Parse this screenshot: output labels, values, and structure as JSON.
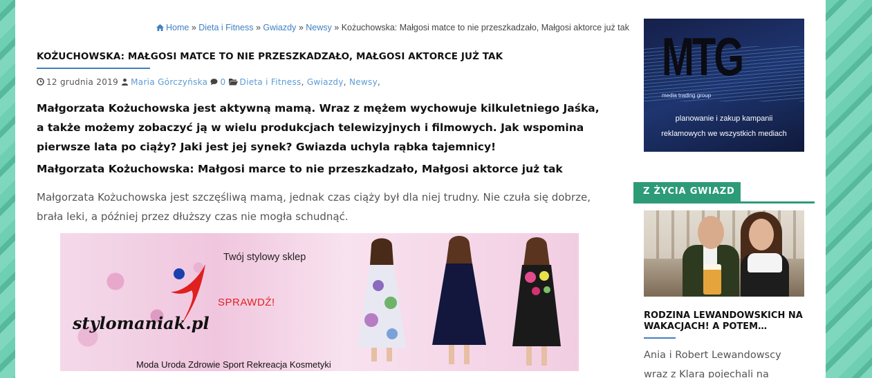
{
  "breadcrumb": {
    "home": "Home",
    "sep": "»",
    "items": [
      "Dieta i Fitness",
      "Gwiazdy",
      "Newsy"
    ],
    "current": "Kożuchowska: Małgosi matce to nie przeszkadzało, Małgosi aktorce już tak"
  },
  "post": {
    "title": "KOŻUCHOWSKA: MAŁGOSI MATCE TO NIE PRZESZKADZAŁO, MAŁGOSI AKTORCE JUŻ TAK",
    "meta": {
      "date": "12 grudnia 2019",
      "author": "Maria Górczyńska",
      "comments": "0",
      "categories": [
        "Dieta i Fitness",
        "Gwiazdy",
        "Newsy"
      ]
    },
    "lead": "Małgorzata Kożuchowska jest aktywną mamą. Wraz z mężem wychowuje kilkuletniego Jaśka, a także możemy zobaczyć ją w wielu produkcjach telewizyjnych i filmowych. Jak wspomina pierwsze lata po ciąży? Jaki jest jej synek? Gwiazda uchyla rąbka tajemnicy!",
    "subheading": "Małgorzata Kożuchowska: Małgosi marce to nie przeszkadzało, Małgosi aktorce już tak",
    "body": "Małgorzata Kożuchowska jest szczęśliwą mamą, jednak czas ciąży był dla niej trudny. Nie czuła się dobrze, brała leki, a później przez dłuższy czas nie mogła schudnąć."
  },
  "banner": {
    "tagline": "Twój stylowy sklep",
    "logo": "stylomaniak.pl",
    "cta": "SPRAWDŹ!",
    "footer": "Moda Uroda Zdrowie Sport Rekreacja Kosmetyki"
  },
  "sidebar": {
    "ad": {
      "logo": "MTG",
      "logo_sub": "media trading group",
      "line1": "planowanie i zakup kampanii",
      "line2": "reklamowych we wszystkich mediach"
    },
    "widget": {
      "title": "Z ŻYCIA GWIAZD",
      "post_title": "RODZINA LEWANDOWSKICH NA WAKACJACH! A POTEM…",
      "excerpt": "Ania i Robert Lewandowscy wraz z Klarą pojechali na"
    }
  },
  "colors": {
    "link": "#3f7fc1",
    "accent_green": "#2d9b78",
    "background": "#5fc3a6"
  }
}
